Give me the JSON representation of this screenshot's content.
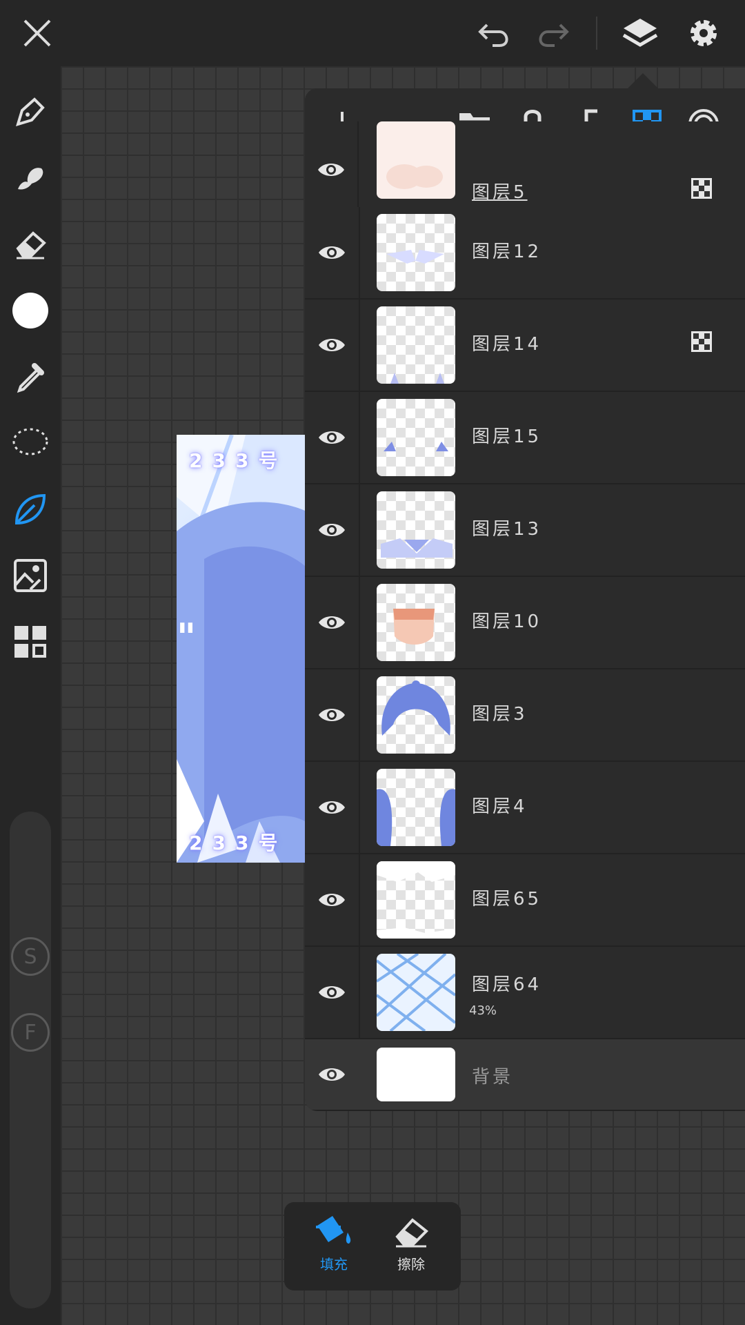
{
  "topbar": {
    "close_icon": "close-icon",
    "undo_icon": "undo-icon",
    "redo_icon": "redo-icon",
    "layers_icon": "layers-icon",
    "settings_icon": "gear-icon"
  },
  "left_tools": [
    {
      "name": "pen-tool",
      "icon": "pen-icon"
    },
    {
      "name": "smudge-tool",
      "icon": "smudge-icon"
    },
    {
      "name": "eraser-tool",
      "icon": "eraser-icon"
    },
    {
      "name": "color-picker",
      "icon": "color-swatch",
      "color": "#ffffff"
    },
    {
      "name": "eyedropper-tool",
      "icon": "eyedropper-icon"
    },
    {
      "name": "lasso-tool",
      "icon": "lasso-icon"
    },
    {
      "name": "fill-tool",
      "icon": "leaf-icon",
      "active": true
    },
    {
      "name": "image-import",
      "icon": "image-icon"
    },
    {
      "name": "more-tools",
      "icon": "grid-icon"
    }
  ],
  "slider": {
    "s_label": "S",
    "f_label": "F"
  },
  "artwork": {
    "top_text": "233号",
    "bottom_text": "233号",
    "quote": "\""
  },
  "layers_panel": {
    "header_icons": [
      "add-icon",
      "folder-icon",
      "lock-icon",
      "merge-down-icon",
      "checker-icon",
      "target-icon"
    ],
    "layers": [
      {
        "name": "图层5",
        "sub": "",
        "has_mask": true,
        "selected": true
      },
      {
        "name": "图层12",
        "sub": "",
        "has_mask": false
      },
      {
        "name": "图层14",
        "sub": "",
        "has_mask": true
      },
      {
        "name": "图层15",
        "sub": "",
        "has_mask": false
      },
      {
        "name": "图层13",
        "sub": "",
        "has_mask": false
      },
      {
        "name": "图层10",
        "sub": "",
        "has_mask": false
      },
      {
        "name": "图层3",
        "sub": "",
        "has_mask": false
      },
      {
        "name": "图层4",
        "sub": "",
        "has_mask": false
      },
      {
        "name": "图层65",
        "sub": "",
        "has_mask": false
      },
      {
        "name": "图层64",
        "sub": "43%",
        "has_mask": false
      }
    ],
    "background_label": "背景"
  },
  "bottom_tools": {
    "fill_label": "填充",
    "erase_label": "擦除",
    "active_color": "#2196f3"
  }
}
